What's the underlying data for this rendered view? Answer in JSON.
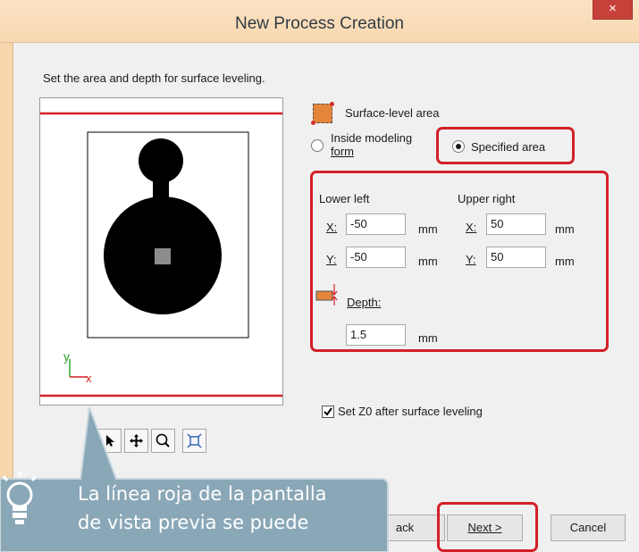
{
  "window": {
    "title": "New Process Creation",
    "close_glyph": "×",
    "accent_color": "#d32027"
  },
  "instruction": "Set the area and depth for surface leveling.",
  "surface_area": {
    "label": "Surface-level area",
    "icon": "surface-area-icon",
    "option_inside": "Inside modeling form",
    "option_inside_line1": "Inside modeling",
    "option_inside_line2": "form",
    "option_specified": "Specified area",
    "selected": "Specified area"
  },
  "lower_left": {
    "heading": "Lower left",
    "x_label": "X:",
    "x_value": "-50",
    "y_label": "Y:",
    "y_value": "-50",
    "unit": "mm"
  },
  "upper_right": {
    "heading": "Upper right",
    "x_label": "X:",
    "x_value": "50",
    "y_label": "Y:",
    "y_value": "50",
    "unit": "mm"
  },
  "depth": {
    "label": "Depth:",
    "value": "1.5",
    "unit": "mm",
    "icon": "depth-icon"
  },
  "set_z0": {
    "label": "Set Z0 after surface leveling",
    "checked": true
  },
  "preview_toolbar": [
    "select-arrow-icon",
    "pan-icon",
    "zoom-icon",
    "fit-view-icon"
  ],
  "preview_axes": {
    "y": "y",
    "x": "x"
  },
  "buttons": {
    "back": "ack",
    "next": "Next >",
    "cancel": "Cancel"
  },
  "callout": {
    "line1": "La línea roja de la pantalla",
    "line2": "de vista previa se puede",
    "icon": "lightbulb-icon"
  }
}
